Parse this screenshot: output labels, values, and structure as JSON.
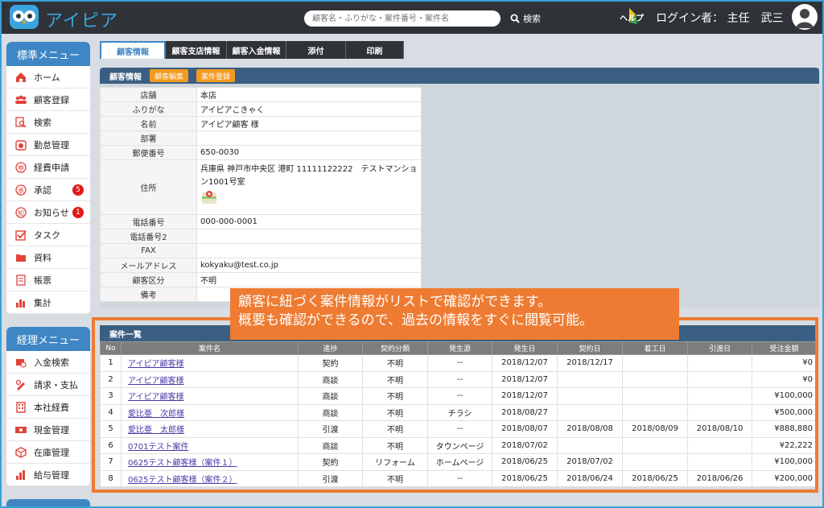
{
  "header": {
    "app_name": "アイピア",
    "search_placeholder": "顧客名・ふりがな・案件番号・案件名",
    "search_label": "検索",
    "help_label": "ヘルプ",
    "login_label": "ログイン者：",
    "user_name": "主任　武三"
  },
  "standard_menu": {
    "title": "標準メニュー",
    "items": [
      {
        "label": "ホーム",
        "icon": "home-icon",
        "badge": ""
      },
      {
        "label": "顧客登録",
        "icon": "users-icon",
        "badge": ""
      },
      {
        "label": "検索",
        "icon": "search-icon",
        "badge": ""
      },
      {
        "label": "勤怠管理",
        "icon": "timecard-icon",
        "badge": ""
      },
      {
        "label": "経費申請",
        "icon": "expense-icon",
        "badge": ""
      },
      {
        "label": "承認",
        "icon": "approval-icon",
        "badge": "5"
      },
      {
        "label": "お知らせ",
        "icon": "notice-icon",
        "badge": "1"
      },
      {
        "label": "タスク",
        "icon": "task-icon",
        "badge": ""
      },
      {
        "label": "資料",
        "icon": "folder-icon",
        "badge": ""
      },
      {
        "label": "帳票",
        "icon": "report-icon",
        "badge": ""
      },
      {
        "label": "集計",
        "icon": "chart-icon",
        "badge": ""
      }
    ]
  },
  "accounting_menu": {
    "title": "経理メニュー",
    "items": [
      {
        "label": "入金検索",
        "icon": "deposit-search-icon"
      },
      {
        "label": "請求・支払",
        "icon": "billing-icon"
      },
      {
        "label": "本社経費",
        "icon": "hq-expense-icon"
      },
      {
        "label": "現金管理",
        "icon": "cash-icon"
      },
      {
        "label": "在庫管理",
        "icon": "inventory-icon"
      },
      {
        "label": "給与管理",
        "icon": "payroll-icon"
      }
    ]
  },
  "tabs": [
    "顧客情報",
    "顧客支店情報",
    "顧客入金情報",
    "添付",
    "印刷"
  ],
  "customer_panel": {
    "title": "顧客情報",
    "edit_button": "顧客編集",
    "register_case_button": "案件登録",
    "fields": [
      {
        "key": "店舗",
        "value": "本店"
      },
      {
        "key": "ふりがな",
        "value": "アイピアこきゃく"
      },
      {
        "key": "名前",
        "value": "アイピア顧客 様"
      },
      {
        "key": "部署",
        "value": ""
      },
      {
        "key": "郵便番号",
        "value": "650-0030"
      },
      {
        "key": "住所",
        "value": "兵庫県 神戸市中央区 港町 11111122222　テストマンション1001号室"
      },
      {
        "key": "電話番号",
        "value": "000-000-0001"
      },
      {
        "key": "電話番号2",
        "value": ""
      },
      {
        "key": "FAX",
        "value": ""
      },
      {
        "key": "メールアドレス",
        "value": "kokyaku@test.co.jp"
      },
      {
        "key": "顧客区分",
        "value": "不明"
      },
      {
        "key": "備考",
        "value": ""
      }
    ]
  },
  "callout": {
    "line1": "顧客に紐づく案件情報がリストで確認ができます。",
    "line2": "概要も確認ができるので、過去の情報をすぐに閲覧可能。"
  },
  "case_list": {
    "title": "案件一覧",
    "columns": [
      "No",
      "案件名",
      "進捗",
      "契約分類",
      "発生源",
      "発生日",
      "契約日",
      "着工日",
      "引渡日",
      "受注金額"
    ],
    "rows": [
      [
        "1",
        "アイピア顧客様",
        "契約",
        "不明",
        "--",
        "2018/12/07",
        "2018/12/17",
        "",
        "",
        "¥0"
      ],
      [
        "2",
        "アイピア顧客様",
        "商談",
        "不明",
        "--",
        "2018/12/07",
        "",
        "",
        "",
        "¥0"
      ],
      [
        "3",
        "アイピア顧客様",
        "商談",
        "不明",
        "--",
        "2018/12/07",
        "",
        "",
        "",
        "¥100,000"
      ],
      [
        "4",
        "愛比亜　次郎様",
        "商談",
        "不明",
        "チラシ",
        "2018/08/27",
        "",
        "",
        "",
        "¥500,000"
      ],
      [
        "5",
        "愛比亜　太郎様",
        "引渡",
        "不明",
        "--",
        "2018/08/07",
        "2018/08/08",
        "2018/08/09",
        "2018/08/10",
        "¥888,880"
      ],
      [
        "6",
        "0701テスト案件",
        "商談",
        "不明",
        "タウンページ",
        "2018/07/02",
        "",
        "",
        "",
        "¥22,222"
      ],
      [
        "7",
        "0625テスト顧客様（案件１）",
        "契約",
        "リフォーム",
        "ホームページ",
        "2018/06/25",
        "2018/07/02",
        "",
        "",
        "¥100,000"
      ],
      [
        "8",
        "0625テスト顧客様（案件２）",
        "引渡",
        "不明",
        "--",
        "2018/06/25",
        "2018/06/24",
        "2018/06/25",
        "2018/06/26",
        "¥200,000"
      ]
    ]
  },
  "colors": {
    "accent_blue": "#3f86c4",
    "header_dark": "#2f3338",
    "orange": "#ee7b32",
    "badge_red": "#e21a1a"
  }
}
